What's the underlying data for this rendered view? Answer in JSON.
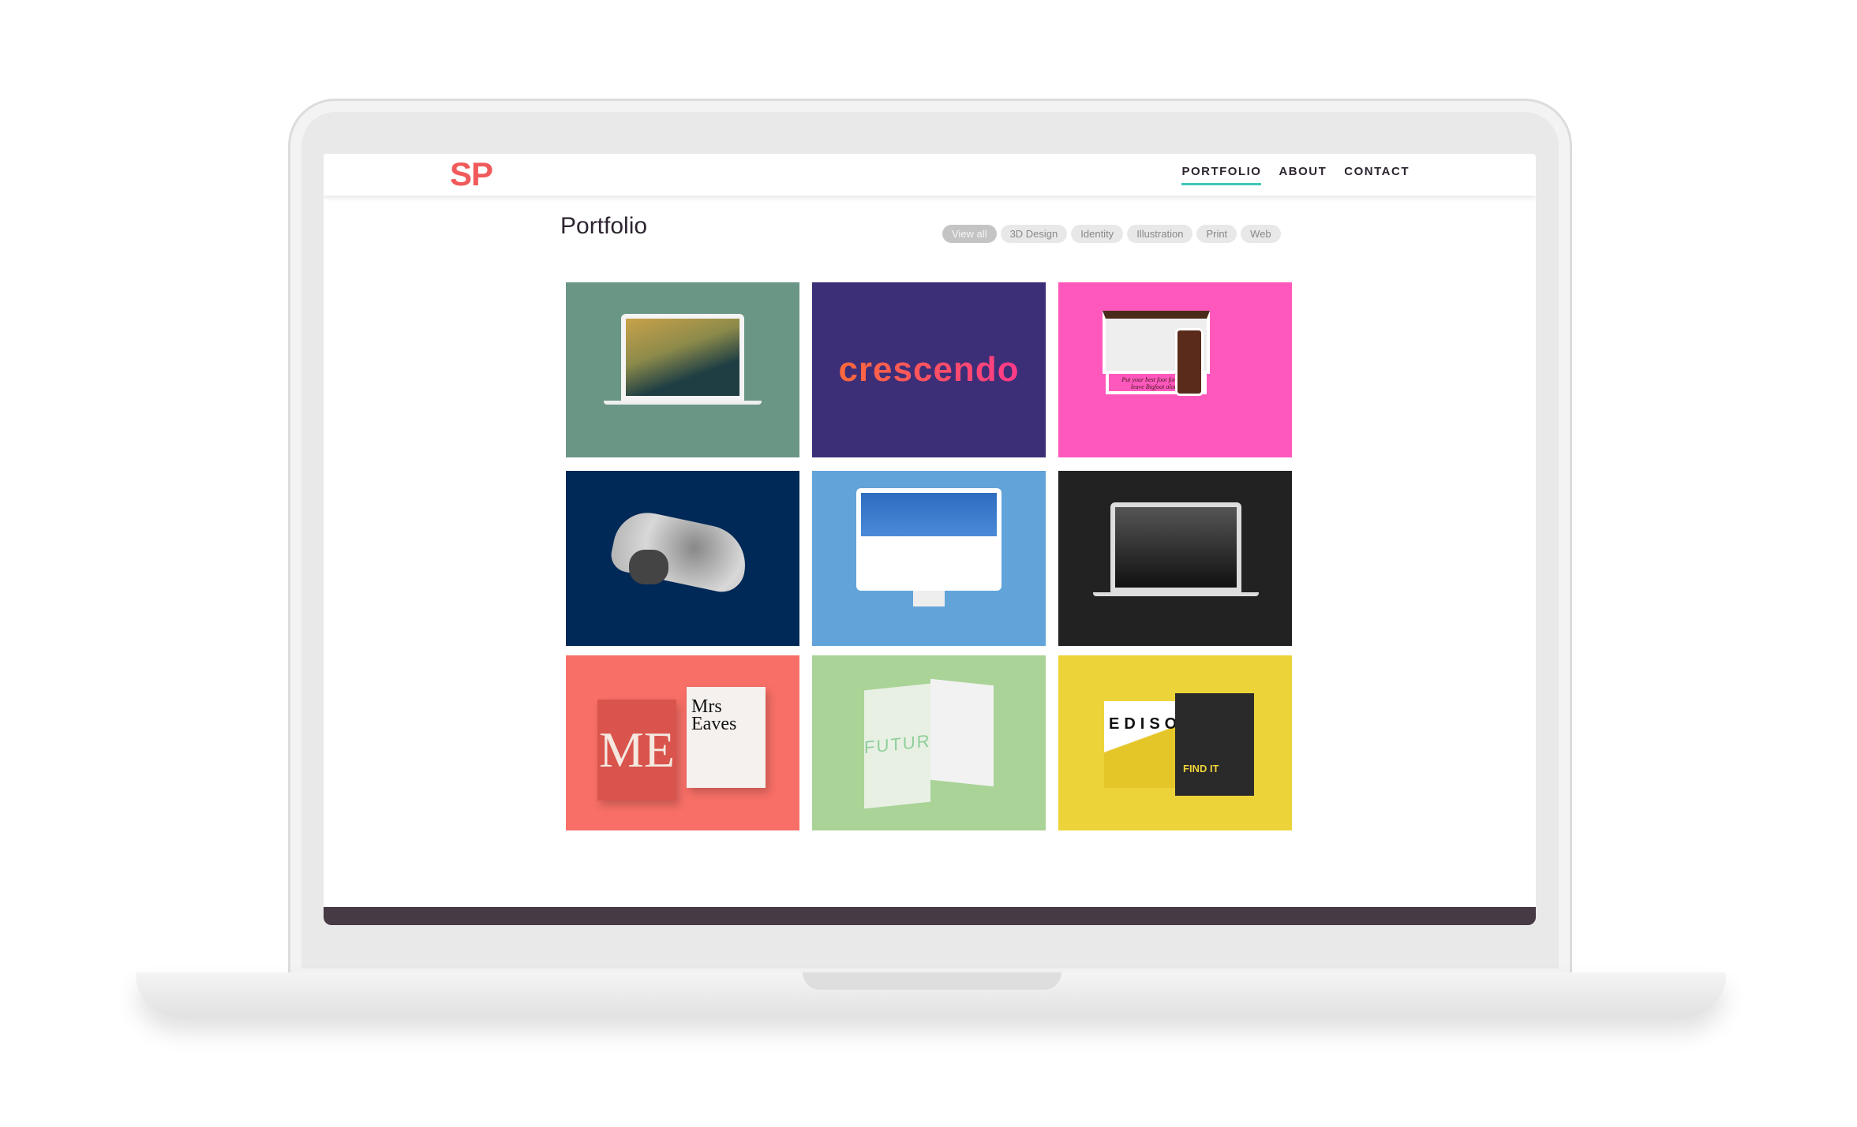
{
  "nav": {
    "logo": "SP",
    "links": [
      {
        "label": "PORTFOLIO",
        "active": true
      },
      {
        "label": "ABOUT"
      },
      {
        "label": "CONTACT"
      }
    ]
  },
  "page": {
    "title": "Portfolio"
  },
  "filters": [
    {
      "label": "View all",
      "active": true
    },
    {
      "label": "3D Design"
    },
    {
      "label": "Identity"
    },
    {
      "label": "Illustration"
    },
    {
      "label": "Print"
    },
    {
      "label": "Web"
    }
  ],
  "tiles": [
    {
      "bg": "#6a9686",
      "kind": "laptop-illustration"
    },
    {
      "bg": "#3d2e78",
      "kind": "logo",
      "text": "crescendo"
    },
    {
      "bg": "#ff58bd",
      "kind": "bigfoot-web",
      "text": "Put your best foot forward: leave Bigfoot alone."
    },
    {
      "bg": "#002957",
      "kind": "3d-vehicle"
    },
    {
      "bg": "#62a4da",
      "kind": "desktop-web"
    },
    {
      "bg": "#222222",
      "kind": "laptop-dark"
    },
    {
      "bg": "#f76f66",
      "kind": "print-mrs-eaves",
      "text": "Mrs Eaves",
      "mark": "ME"
    },
    {
      "bg": "#aad397",
      "kind": "print-futura",
      "text": "FUTURA"
    },
    {
      "bg": "#edd33a",
      "kind": "print-edison",
      "text": "EDISON",
      "tagline": "FIND IT"
    }
  ],
  "colors": {
    "accent": "#f05a5a",
    "nav_underline": "#3fc8b6",
    "footer": "#463a44"
  }
}
